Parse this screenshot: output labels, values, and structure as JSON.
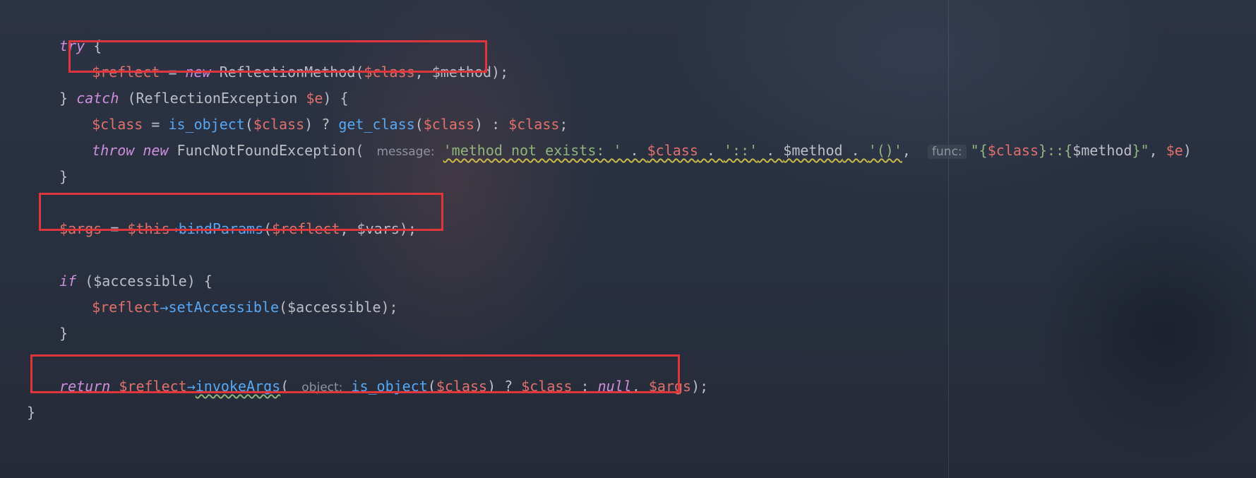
{
  "code": {
    "l1_try": "try",
    "l1_brace": " {",
    "l2_var": "$reflect",
    "l2_eq": " = ",
    "l2_new": "new",
    "l2_cls": " ReflectionMethod(",
    "l2_a1": "$class",
    "l2_rest": ", $method);",
    "l3_close": "} ",
    "l3_catch": "catch",
    "l3_mid": " (ReflectionException ",
    "l3_e": "$e",
    "l3_end": ") {",
    "l4_var": "$class",
    "l4_eq": " = ",
    "l4_fn1": "is_object",
    "l4_p1": "(",
    "l4_a1": "$class",
    "l4_p2": ") ? ",
    "l4_fn2": "get_class",
    "l4_p3": "(",
    "l4_a2": "$class",
    "l4_p4": ") : ",
    "l4_a3": "$class",
    "l4_end": ";",
    "l5_throw": "throw",
    "l5_new": "new",
    "l5_cls": " FuncNotFoundException(",
    "l5_hint1": "message:",
    "l5_s1": "'method not exists: '",
    "l5_dot1": " . ",
    "l5_v1": "$class",
    "l5_dot2": " . ",
    "l5_s2": "'::'",
    "l5_dot3": " . ",
    "l5_v2": "$method",
    "l5_dot4": " . ",
    "l5_s3": "'()'",
    "l5_comma": ",",
    "l5_hint2": "func:",
    "l5_q1": "\"{",
    "l5_v3": "$class",
    "l5_mid": "}::{",
    "l5_v4": "$method",
    "l5_q2": "}\"",
    "l5_end": ", ",
    "l5_e": "$e",
    "l5_close": ")",
    "l6": "}",
    "l8_v1": "$args",
    "l8_eq": " = ",
    "l8_this": "$this",
    "l8_arrow": "→",
    "l8_fn": "bindParams",
    "l8_p": "(",
    "l8_v2": "$reflect",
    "l8_rest": ", $vars);",
    "l10_if": "if",
    "l10_rest": " ($accessible) {",
    "l11_v": "$reflect",
    "l11_arrow": "→",
    "l11_fn": "setAccessible",
    "l11_rest": "($accessible);",
    "l12": "}",
    "l14_ret": "return",
    "l14_sp": " ",
    "l14_v": "$reflect",
    "l14_arrow": "→",
    "l14_fn": "invokeArgs",
    "l14_p": "(",
    "l14_hint": "object:",
    "l14_fn2": "is_object",
    "l14_p2": "(",
    "l14_a1": "$class",
    "l14_p3": ") ? ",
    "l14_a2": "$class",
    "l14_p4": " : ",
    "l14_null": "null",
    "l14_p5": ", ",
    "l14_a3": "$args",
    "l14_end": ");",
    "l15": "}"
  },
  "colors": {
    "keyword": "#cf8edc",
    "variable": "#e0716a",
    "function": "#56a8f5",
    "string": "#8fb57c",
    "text": "#bcbec4",
    "highlight_box": "#e0353a"
  }
}
